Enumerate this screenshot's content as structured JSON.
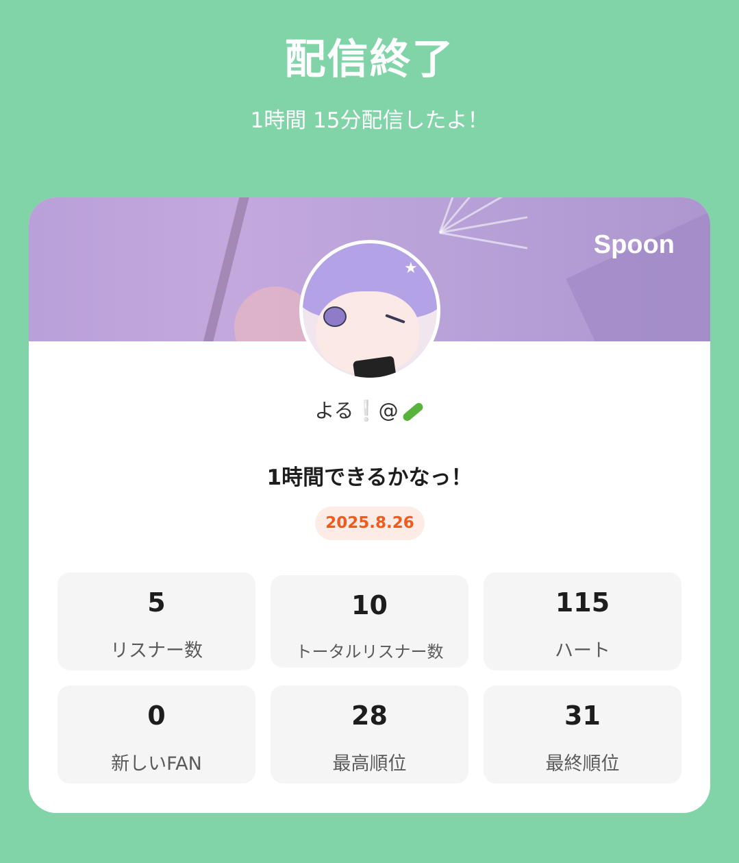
{
  "header": {
    "title": "配信終了",
    "subtitle": "1時間 15分配信したよ！"
  },
  "card": {
    "brand": "Spoon",
    "username": "よる❕@",
    "stream_title": "1時間できるかなっ！",
    "date": "2025.8.26",
    "stats": [
      {
        "value": "5",
        "label": "リスナー数"
      },
      {
        "value": "10",
        "label": "トータルリスナー数"
      },
      {
        "value": "115",
        "label": "ハート"
      },
      {
        "value": "0",
        "label": "新しいFAN"
      },
      {
        "value": "28",
        "label": "最高順位"
      },
      {
        "value": "31",
        "label": "最終順位"
      }
    ]
  },
  "colors": {
    "background": "#80d4a8",
    "banner": "#b9a0d8",
    "date_text": "#f05a1e",
    "date_bg": "#fdece6",
    "stat_bg": "#f5f5f5"
  }
}
